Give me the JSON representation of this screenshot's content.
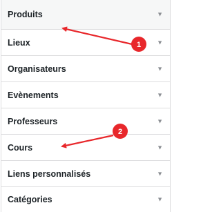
{
  "menu": {
    "items": [
      {
        "label": "Produits",
        "caret_icon": "caret-down-icon"
      },
      {
        "label": "Lieux",
        "caret_icon": "caret-down-icon"
      },
      {
        "label": "Organisateurs",
        "caret_icon": "caret-down-icon"
      },
      {
        "label": "Evènements",
        "caret_icon": "caret-down-icon"
      },
      {
        "label": "Professeurs",
        "caret_icon": "caret-down-icon"
      },
      {
        "label": "Cours",
        "caret_icon": "caret-down-icon"
      },
      {
        "label": "Liens personnalisés",
        "caret_icon": "caret-down-icon"
      },
      {
        "label": "Catégories",
        "caret_icon": "caret-down-icon"
      }
    ],
    "caret_glyph": "▼"
  },
  "annotations": [
    {
      "number": "1",
      "points_to": "Produits"
    },
    {
      "number": "2",
      "points_to": "Cours"
    }
  ],
  "colors": {
    "annotation_red": "#e8272b",
    "border": "#dcdcde",
    "text": "#1d2327",
    "caret": "#8c8f94"
  }
}
